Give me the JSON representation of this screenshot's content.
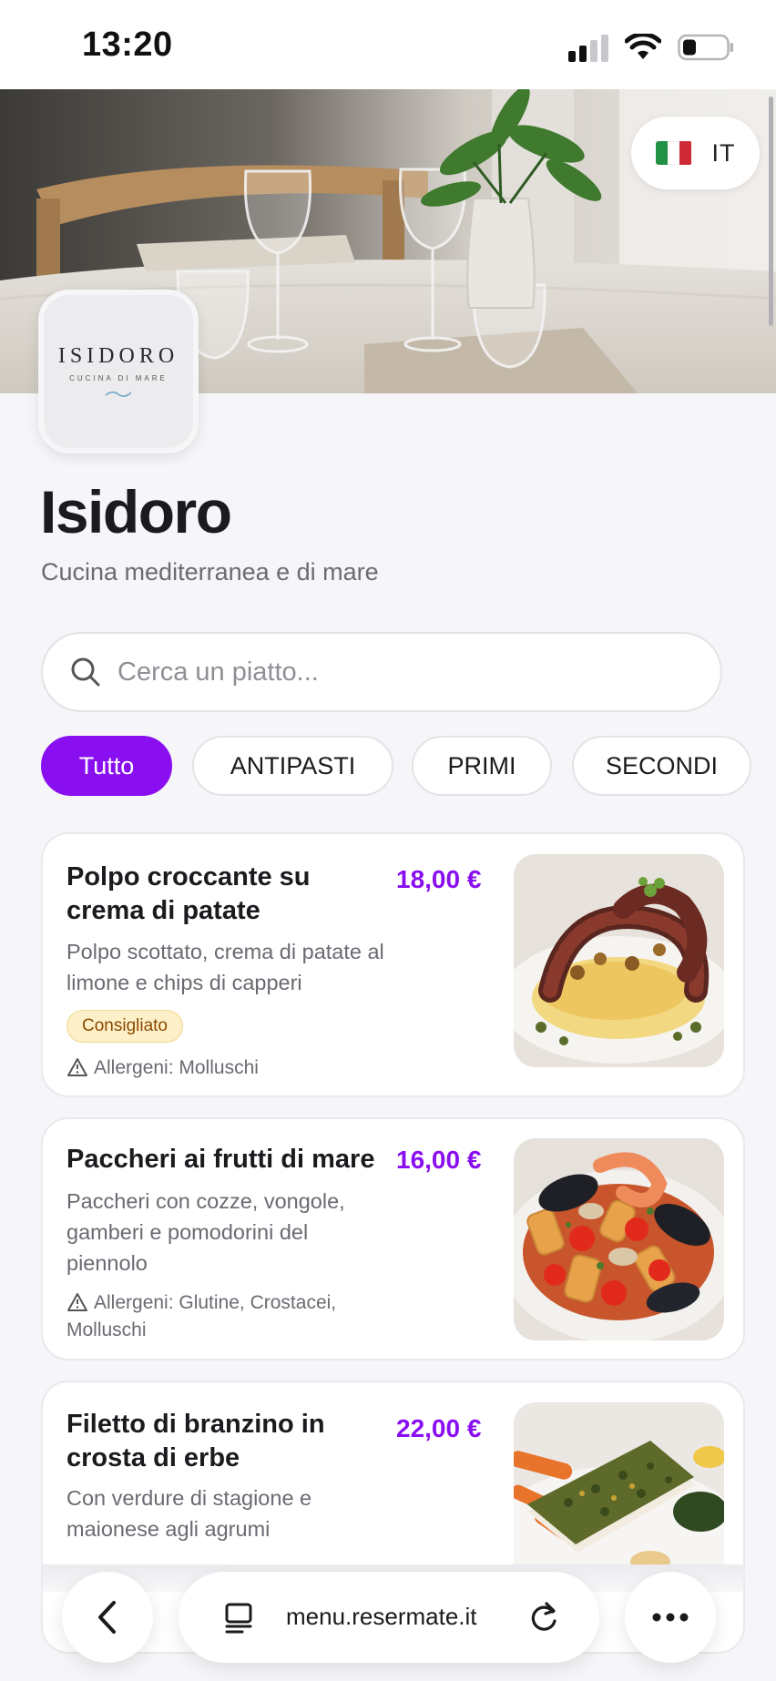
{
  "status_bar": {
    "time": "13:20"
  },
  "language": {
    "code": "IT",
    "flag_colors": [
      "#229146",
      "#ffffff",
      "#ce2b37"
    ]
  },
  "logo": {
    "name": "ISIDORO",
    "tagline": "CUCINA DI MARE"
  },
  "restaurant": {
    "name": "Isidoro",
    "subtitle": "Cucina mediterranea e di mare"
  },
  "search": {
    "placeholder": "Cerca un piatto..."
  },
  "categories": [
    {
      "label": "Tutto",
      "active": true
    },
    {
      "label": "ANTIPASTI",
      "active": false
    },
    {
      "label": "PRIMI",
      "active": false
    },
    {
      "label": "SECONDI",
      "active": false
    }
  ],
  "dishes": [
    {
      "title": "Polpo croccante su crema di patate",
      "price": "18,00 €",
      "description": "Polpo scottato, crema di patate al limone e chips di capperi",
      "badge": "Consigliato",
      "allergens": "Allergeni: Molluschi"
    },
    {
      "title": "Paccheri ai frutti di mare",
      "price": "16,00 €",
      "description": "Paccheri con cozze, vongole, gamberi e pomodorini del piennolo",
      "allergens": "Allergeni: Glutine, Crostacei, Molluschi"
    },
    {
      "title": "Filetto di branzino in crosta di erbe",
      "price": "22,00 €",
      "description": "Con verdure di stagione e maionese agli agrumi"
    }
  ],
  "browser": {
    "url": "menu.resermate.it"
  },
  "colors": {
    "accent": "#8a0ff0",
    "badge_bg": "#fdf0c8",
    "badge_text": "#8a4a00"
  }
}
